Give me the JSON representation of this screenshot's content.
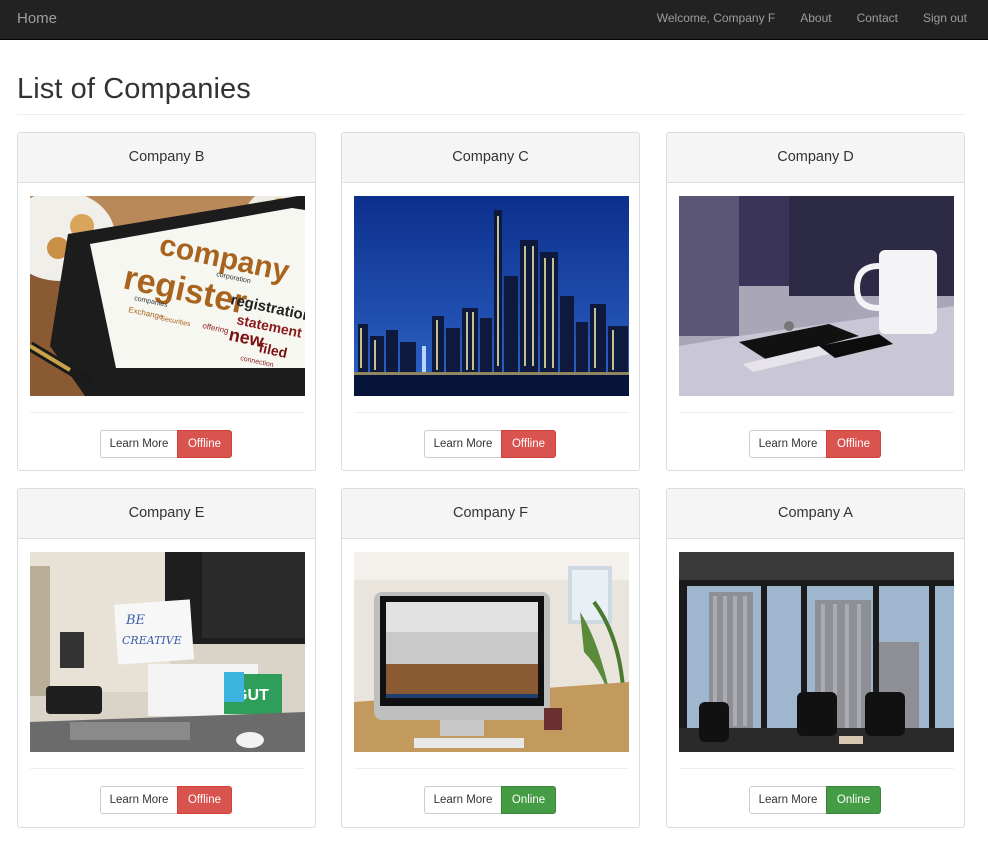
{
  "navbar": {
    "brand": "Home",
    "welcome": "Welcome, Company F",
    "about": "About",
    "contact": "Contact",
    "signout": "Sign out"
  },
  "page": {
    "title": "List of Companies"
  },
  "companies": [
    {
      "name": "Company B",
      "learn_label": "Learn More",
      "status_label": "Offline",
      "status": "offline",
      "image": "tablet-word-cloud-photo"
    },
    {
      "name": "Company C",
      "learn_label": "Learn More",
      "status_label": "Offline",
      "status": "offline",
      "image": "city-skyline-night-photo"
    },
    {
      "name": "Company D",
      "learn_label": "Learn More",
      "status_label": "Offline",
      "status": "offline",
      "image": "desk-mug-phone-photo"
    },
    {
      "name": "Company E",
      "learn_label": "Learn More",
      "status_label": "Offline",
      "status": "offline",
      "image": "office-desk-monitor-photo"
    },
    {
      "name": "Company F",
      "learn_label": "Learn More",
      "status_label": "Online",
      "status": "online",
      "image": "imac-room-photo"
    },
    {
      "name": "Company A",
      "learn_label": "Learn More",
      "status_label": "Online",
      "status": "online",
      "image": "office-window-skyscrapers-photo"
    }
  ],
  "image_text": {
    "word_cloud": [
      "company",
      "register",
      "registration",
      "statement",
      "new",
      "filed",
      "corporation",
      "companies",
      "Exchange",
      "Securities",
      "offering",
      "connection"
    ],
    "sticky_note": [
      "BE",
      "CREATIVE"
    ],
    "gut_sign": "GUT"
  },
  "colors": {
    "navbar_bg": "#222222",
    "nav_text": "#9d9d9d",
    "offline": "#d9534f",
    "online": "#449d44",
    "panel_heading": "#f5f5f5"
  }
}
